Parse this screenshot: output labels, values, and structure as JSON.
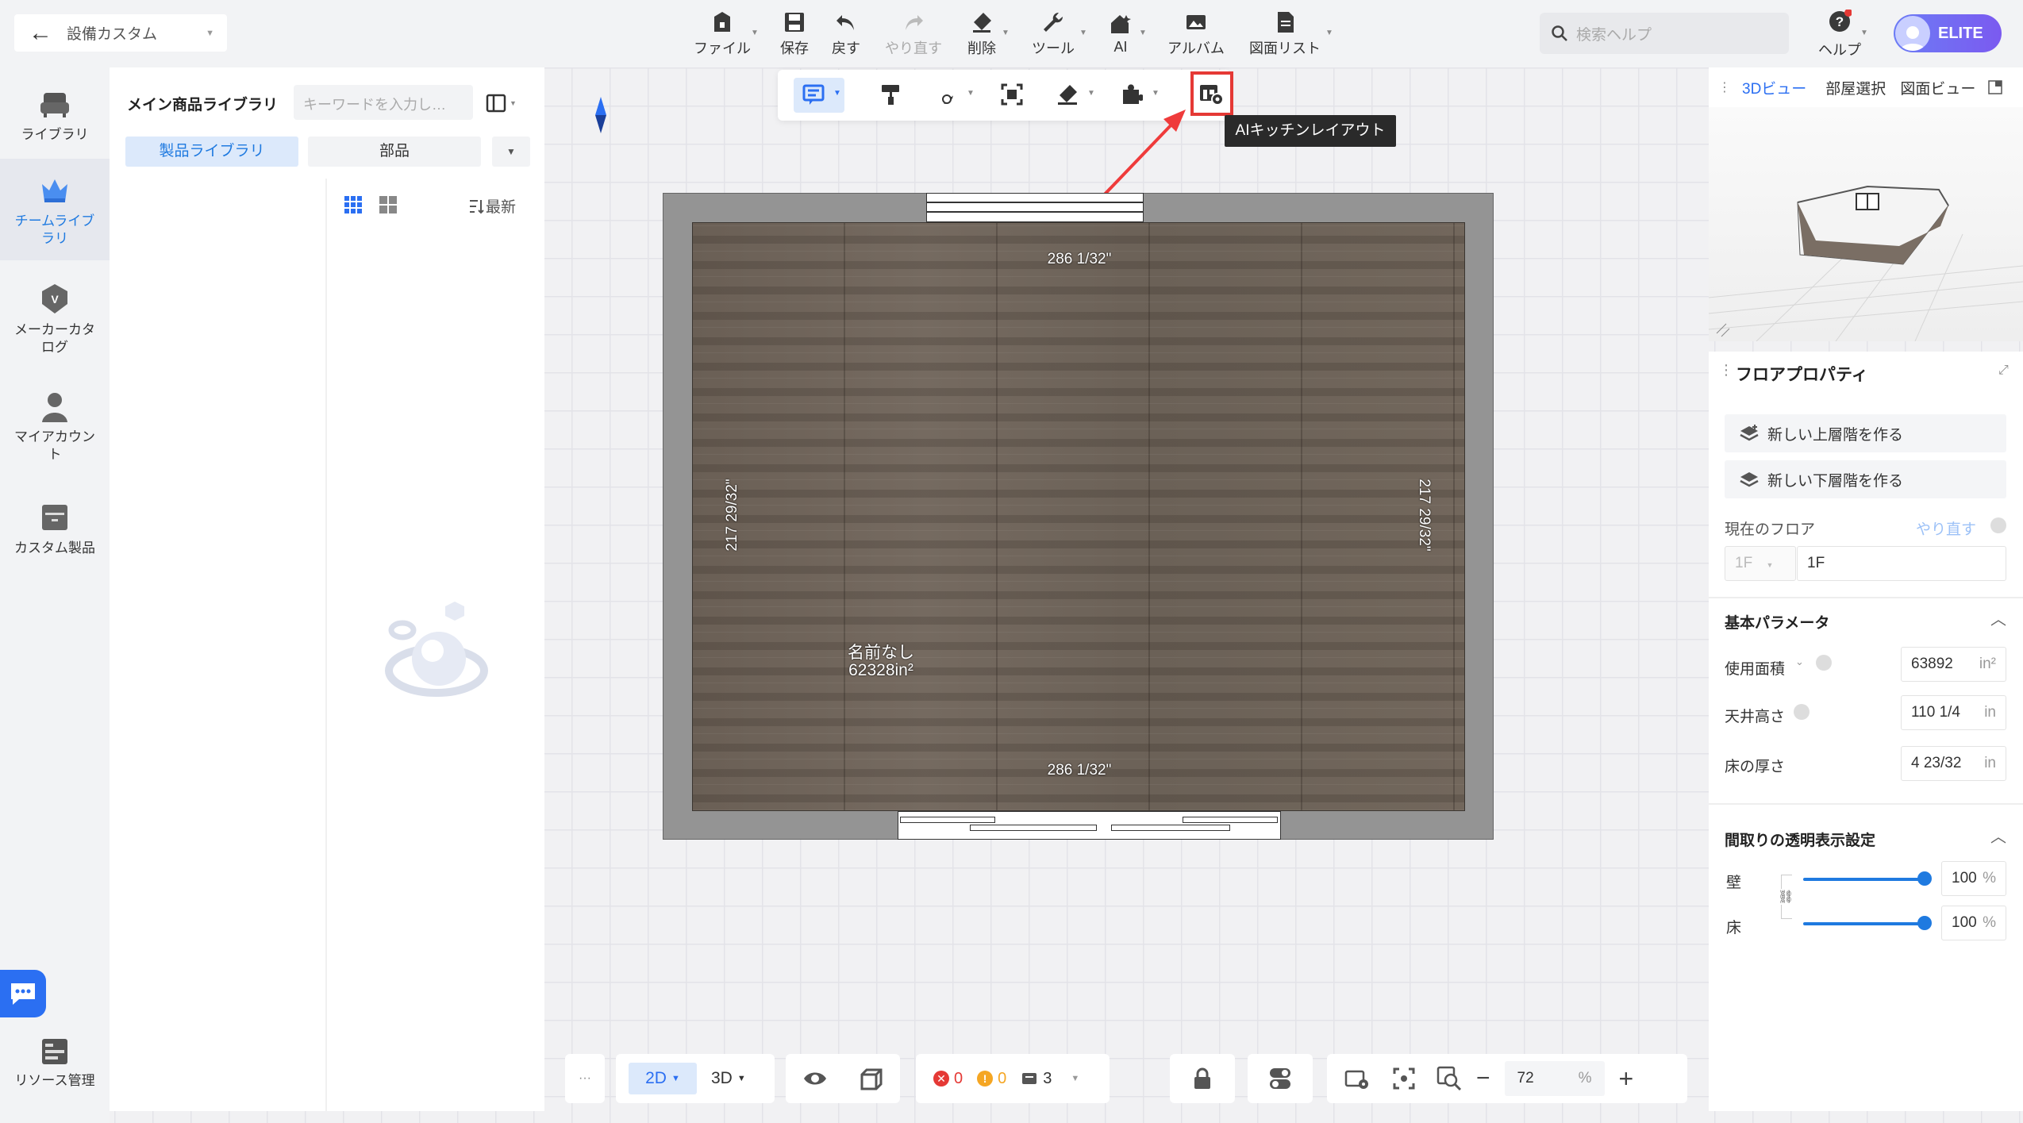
{
  "header": {
    "project_name": "設備カスタム",
    "toolbar": [
      {
        "label": "ファイル",
        "icon": "file-icon"
      },
      {
        "label": "保存",
        "icon": "save-icon"
      },
      {
        "label": "戻す",
        "icon": "undo-icon"
      },
      {
        "label": "やり直す",
        "icon": "redo-icon"
      },
      {
        "label": "削除",
        "icon": "eraser-icon"
      },
      {
        "label": "ツール",
        "icon": "wrench-icon"
      },
      {
        "label": "AI",
        "icon": "ai-house-icon"
      },
      {
        "label": "アルバム",
        "icon": "album-icon"
      },
      {
        "label": "図面リスト",
        "icon": "drawing-list-icon"
      }
    ],
    "search_placeholder": "検索ヘルプ",
    "help_label": "ヘルプ",
    "badge": "ELITE"
  },
  "leftnav": {
    "items": [
      {
        "label": "ライブラリ",
        "icon": "sofa-icon",
        "active": false
      },
      {
        "label": "チームライブラリ",
        "icon": "crown-icon",
        "active": true
      },
      {
        "label": "メーカーカタログ",
        "icon": "vendor-badge-icon",
        "active": false
      },
      {
        "label": "マイアカウント",
        "icon": "user-icon",
        "active": false
      },
      {
        "label": "カスタム製品",
        "icon": "cabinet-icon",
        "active": false
      }
    ],
    "resource_label": "リソース管理"
  },
  "library": {
    "title": "メイン商品ライブラリ",
    "keyword_placeholder": "キーワードを入力し…",
    "tabs": [
      {
        "label": "製品ライブラリ",
        "active": true
      },
      {
        "label": "部品",
        "active": false
      }
    ],
    "sort_label": "最新"
  },
  "canvas": {
    "tooltip": "AIキッチンレイアウト",
    "dim_top": "286 1/32\"",
    "dim_bottom": "286 1/32\"",
    "dim_left": "217 29/32\"",
    "dim_right": "217 29/32\"",
    "room_name": "名前なし",
    "room_area": "62328in²"
  },
  "right": {
    "tabs": [
      {
        "label": "3Dビュー",
        "active": true
      },
      {
        "label": "部屋選択",
        "active": false
      },
      {
        "label": "図面ビュー",
        "active": false
      }
    ],
    "props_title": "フロアプロパティ",
    "btn_upper": "新しい上層階を作る",
    "btn_lower": "新しい下層階を作る",
    "current_floor_label": "現在のフロア",
    "redo_label": "やり直す",
    "floor_select": "1F",
    "floor_name": "1F",
    "basic_params": "基本パラメータ",
    "area_label": "使用面積",
    "area_value": "63892",
    "area_unit": "in²",
    "ceiling_label": "天井高さ",
    "ceiling_value": "110 1/4",
    "ceiling_unit": "in",
    "floor_thick_label": "床の厚さ",
    "floor_thick_value": "4 23/32",
    "floor_thick_unit": "in",
    "transparency_title": "間取りの透明表示設定",
    "wall_label": "壁",
    "wall_value": "100",
    "floor_label": "床",
    "floor_value": "100",
    "percent": "%"
  },
  "bottom": {
    "more": "···",
    "mode_2d": "2D",
    "mode_3d": "3D",
    "errors": "0",
    "warnings": "0",
    "layers": "3",
    "zoom": "72",
    "zoom_unit": "%"
  }
}
